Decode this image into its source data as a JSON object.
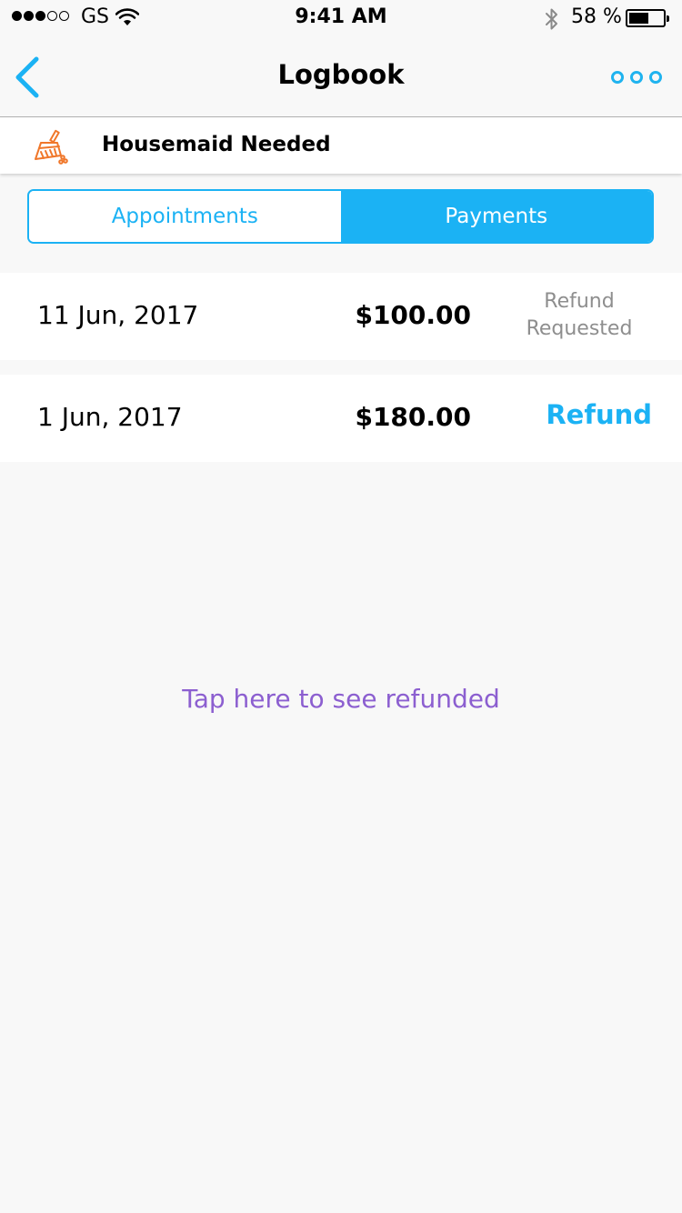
{
  "status_bar": {
    "carrier": "GS",
    "time": "9:41 AM",
    "battery_percent": "58 %",
    "battery_level": 0.58,
    "signal_bars_filled": 3,
    "signal_bars_total": 5,
    "icons": [
      "wifi-icon",
      "bluetooth-icon",
      "battery-icon"
    ]
  },
  "nav": {
    "title": "Logbook",
    "back_icon": "chevron-left-icon",
    "more_icon": "more-dots-icon"
  },
  "job": {
    "icon": "broom-icon",
    "title": "Housemaid Needed"
  },
  "tabs": [
    {
      "label": "Appointments",
      "active": false
    },
    {
      "label": "Payments",
      "active": true
    }
  ],
  "payments": [
    {
      "date": "11 Jun, 2017",
      "amount": "$100.00",
      "status": "Refund Requested",
      "status_line1": "Refund",
      "status_line2": "Requested"
    },
    {
      "date": "1 Jun, 2017",
      "amount": "$180.00",
      "action": "Refund"
    }
  ],
  "refunded_link": "Tap here to see refunded",
  "colors": {
    "accent": "#1bb2f4",
    "icon_orange": "#f0772a",
    "link_purple": "#8c5fd0",
    "muted_text": "#8e8e8e",
    "background": "#f8f8f8"
  }
}
